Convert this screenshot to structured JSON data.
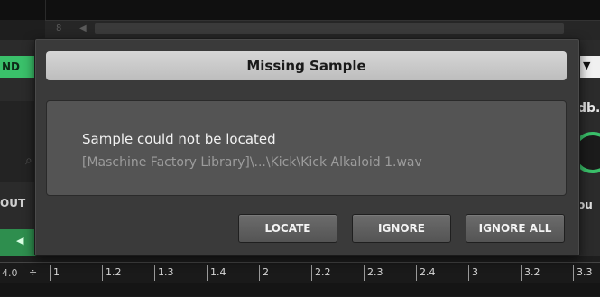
{
  "background": {
    "scroll_label": "8",
    "scroll_arrow": "◀",
    "left_tab_label": "ND",
    "left_out_label": "OUT",
    "left_green_arrow": "◀",
    "right_label_top": "db.",
    "right_label_bottom": "ou",
    "dropdown_caret": "▼",
    "ruler": {
      "zoom": "4.0",
      "spinner": "÷",
      "marks": [
        "1",
        "1.2",
        "1.3",
        "1.4",
        "2",
        "2.2",
        "2.3",
        "2.4",
        "3",
        "3.2",
        "3.3"
      ]
    },
    "accent_color": "#3ac06a"
  },
  "dialog": {
    "title": "Missing Sample",
    "message": "Sample could not be located",
    "path": "[Maschine Factory Library]\\...\\Kick\\Kick Alkaloid 1.wav",
    "buttons": {
      "locate": "LOCATE",
      "ignore": "IGNORE",
      "ignore_all": "IGNORE ALL"
    }
  }
}
